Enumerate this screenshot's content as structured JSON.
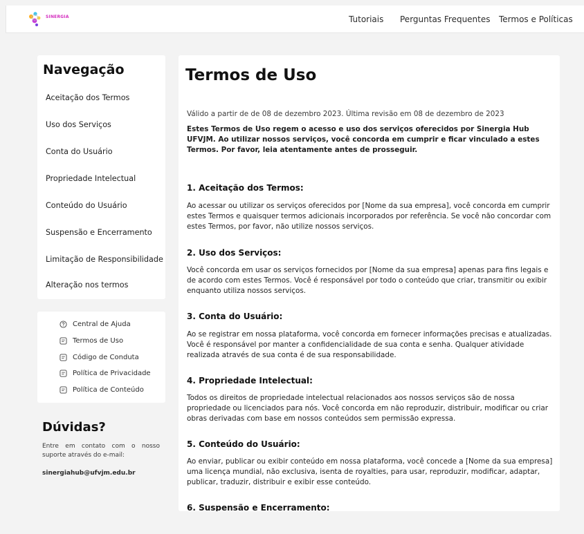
{
  "header": {
    "logo_text": "SINERGIA",
    "nav": [
      "Tutoriais",
      "Perguntas Frequentes",
      "Termos e Políticas"
    ]
  },
  "sidebar": {
    "title": "Navegação",
    "items": [
      "Aceitação dos Termos",
      "Uso dos Serviços",
      "Conta do Usuário",
      "Propriedade Intelectual",
      "Conteúdo do Usuário",
      "Suspensão e Encerramento",
      "Limitação de Responsibilidade",
      "Alteração nos termos"
    ],
    "links": [
      {
        "label": "Central de Ajuda",
        "icon": "help-circle-icon"
      },
      {
        "label": "Termos de Uso",
        "icon": "document-icon"
      },
      {
        "label": "Código de Conduta",
        "icon": "document-icon"
      },
      {
        "label": "Política de Privacidade",
        "icon": "document-icon"
      },
      {
        "label": "Política de Conteúdo",
        "icon": "document-icon"
      }
    ],
    "duvidas": {
      "title": "Dúvidas?",
      "text": "Entre em contato com o nosso suporte através do e-mail:",
      "email": "sinergiahub@ufvjm.edu.br"
    }
  },
  "main": {
    "title": "Termos de Uso",
    "valid": "Válido a partir de de 08 de dezembro 2023. Última revisão em 08 de dezembro de 2023",
    "intro": "Estes Termos de Uso regem o acesso e uso dos serviços oferecidos por Sinergia Hub UFVJM. Ao utilizar nossos serviços, você concorda em cumprir e ficar vinculado a estes Termos. Por favor, leia atentamente antes de prosseguir.",
    "sections": [
      {
        "heading": "1. Aceitação dos Termos:",
        "text": "Ao acessar ou utilizar os serviços oferecidos por [Nome da sua empresa], você concorda em cumprir estes Termos e quaisquer termos adicionais incorporados por referência. Se você não concordar com estes Termos, por favor, não utilize nossos serviços."
      },
      {
        "heading": "2. Uso dos Serviços:",
        "text": "Você concorda em usar os serviços fornecidos por [Nome da sua empresa] apenas para fins legais e de acordo com estes Termos. Você é responsável por todo o conteúdo que criar, transmitir ou exibir enquanto utiliza nossos serviços."
      },
      {
        "heading": "3. Conta do Usuário:",
        "text": "Ao se registrar em nossa plataforma, você concorda em fornecer informações precisas e atualizadas. Você é responsável por manter a confidencialidade de sua conta e senha. Qualquer atividade realizada através de sua conta é de sua responsabilidade."
      },
      {
        "heading": "4. Propriedade Intelectual:",
        "text": "Todos os direitos de propriedade intelectual relacionados aos nossos serviços são de nossa propriedade ou licenciados para nós. Você concorda em não reproduzir, distribuir, modificar ou criar obras derivadas com base em nossos conteúdos sem permissão expressa."
      },
      {
        "heading": "5. Conteúdo do Usuário:",
        "text": "Ao enviar, publicar ou exibir conteúdo em nossa plataforma, você concede a [Nome da sua empresa] uma licença mundial, não exclusiva, isenta de royalties, para usar, reproduzir, modificar, adaptar, publicar, traduzir, distribuir e exibir esse conteúdo."
      },
      {
        "heading": "6. Suspensão e Encerramento:",
        "text": ""
      }
    ]
  }
}
